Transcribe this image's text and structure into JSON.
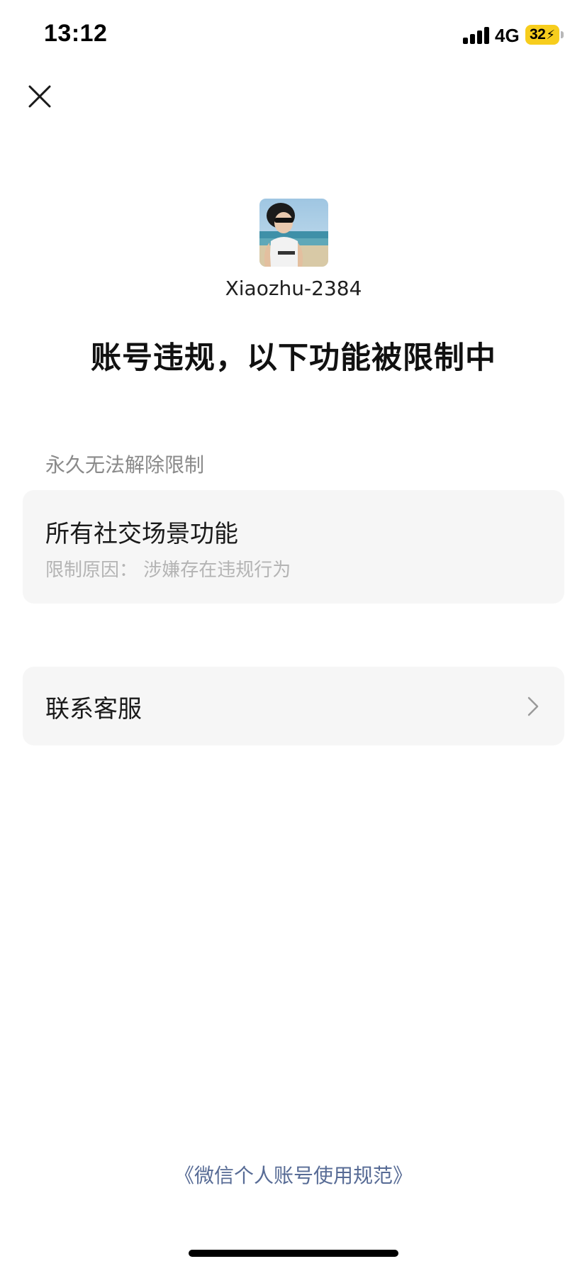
{
  "status_bar": {
    "time": "13:12",
    "network": "4G",
    "battery_level": "32",
    "battery_charging_icon": "bolt-icon"
  },
  "header": {
    "close_icon": "close-icon"
  },
  "profile": {
    "username": "Xiaozhu-2384"
  },
  "title": "账号违规，以下功能被限制中",
  "restriction_section": {
    "label": "永久无法解除限制",
    "item_title": "所有社交场景功能",
    "item_reason": "限制原因： 涉嫌存在违规行为"
  },
  "support": {
    "label": "联系客服",
    "chevron_icon": "chevron-right-icon"
  },
  "footer": {
    "link": "《微信个人账号使用规范》"
  },
  "colors": {
    "link": "#576b95",
    "battery": "#f7cd1d",
    "card_bg": "#f6f6f6"
  }
}
